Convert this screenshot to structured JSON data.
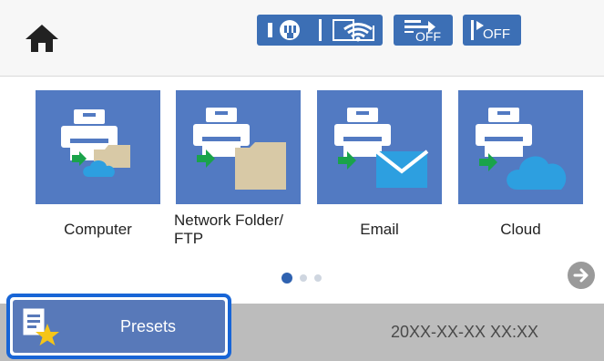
{
  "header": {
    "home_icon": "home-icon",
    "status_icons": [
      "ethernet-icon",
      "wifi-icon",
      "transfer-off-icon",
      "fax-off-icon"
    ],
    "off_label_1": "OFF",
    "off_label_2": "OFF"
  },
  "tiles": [
    {
      "label": "Computer",
      "icon": "computer-scan-icon"
    },
    {
      "label": "Network Folder/ FTP",
      "label_line1": "Network Folder/",
      "label_line2": "FTP",
      "icon": "network-folder-icon"
    },
    {
      "label": "Email",
      "icon": "email-scan-icon"
    },
    {
      "label": "Cloud",
      "icon": "cloud-scan-icon"
    }
  ],
  "pagination": {
    "current_page": 1,
    "total_pages": 3
  },
  "footer": {
    "presets_label": "Presets",
    "presets_icon": "presets-star-icon",
    "datetime": "20XX-XX-XX XX:XX"
  },
  "colors": {
    "accent": "#527ac2",
    "selection": "#1865d6",
    "pill": "#3c6fb5",
    "footer": "#bcbcbc"
  }
}
